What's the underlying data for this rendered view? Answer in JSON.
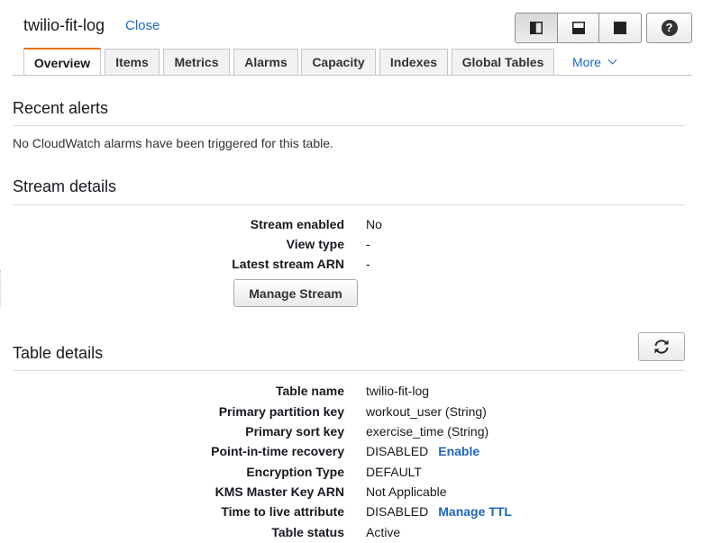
{
  "header": {
    "title": "twilio-fit-log",
    "close_label": "Close"
  },
  "view_controls": {
    "icons": [
      "split-left-icon",
      "split-bottom-icon",
      "full-view-icon"
    ],
    "help_glyph": "?"
  },
  "tabs": [
    {
      "label": "Overview",
      "active": true
    },
    {
      "label": "Items"
    },
    {
      "label": "Metrics"
    },
    {
      "label": "Alarms"
    },
    {
      "label": "Capacity"
    },
    {
      "label": "Indexes"
    },
    {
      "label": "Global Tables"
    },
    {
      "label": "More"
    }
  ],
  "recent_alerts": {
    "title": "Recent alerts",
    "message": "No CloudWatch alarms have been triggered for this table."
  },
  "stream_details": {
    "title": "Stream details",
    "rows": [
      {
        "label": "Stream enabled",
        "value": "No"
      },
      {
        "label": "View type",
        "value": "-"
      },
      {
        "label": "Latest stream ARN",
        "value": "-"
      }
    ],
    "manage_button": "Manage Stream"
  },
  "table_details": {
    "title": "Table details",
    "rows": [
      {
        "label": "Table name",
        "value": "twilio-fit-log"
      },
      {
        "label": "Primary partition key",
        "value": "workout_user (String)"
      },
      {
        "label": "Primary sort key",
        "value": "exercise_time (String)"
      },
      {
        "label": "Point-in-time recovery",
        "value": "DISABLED",
        "link": "Enable"
      },
      {
        "label": "Encryption Type",
        "value": "DEFAULT"
      },
      {
        "label": "KMS Master Key ARN",
        "value": "Not Applicable"
      },
      {
        "label": "Time to live attribute",
        "value": "DISABLED",
        "link": "Manage TTL"
      },
      {
        "label": "Table status",
        "value": "Active"
      }
    ]
  },
  "colors": {
    "link": "#1d67b8",
    "active_tab_accent": "#ec7211"
  }
}
